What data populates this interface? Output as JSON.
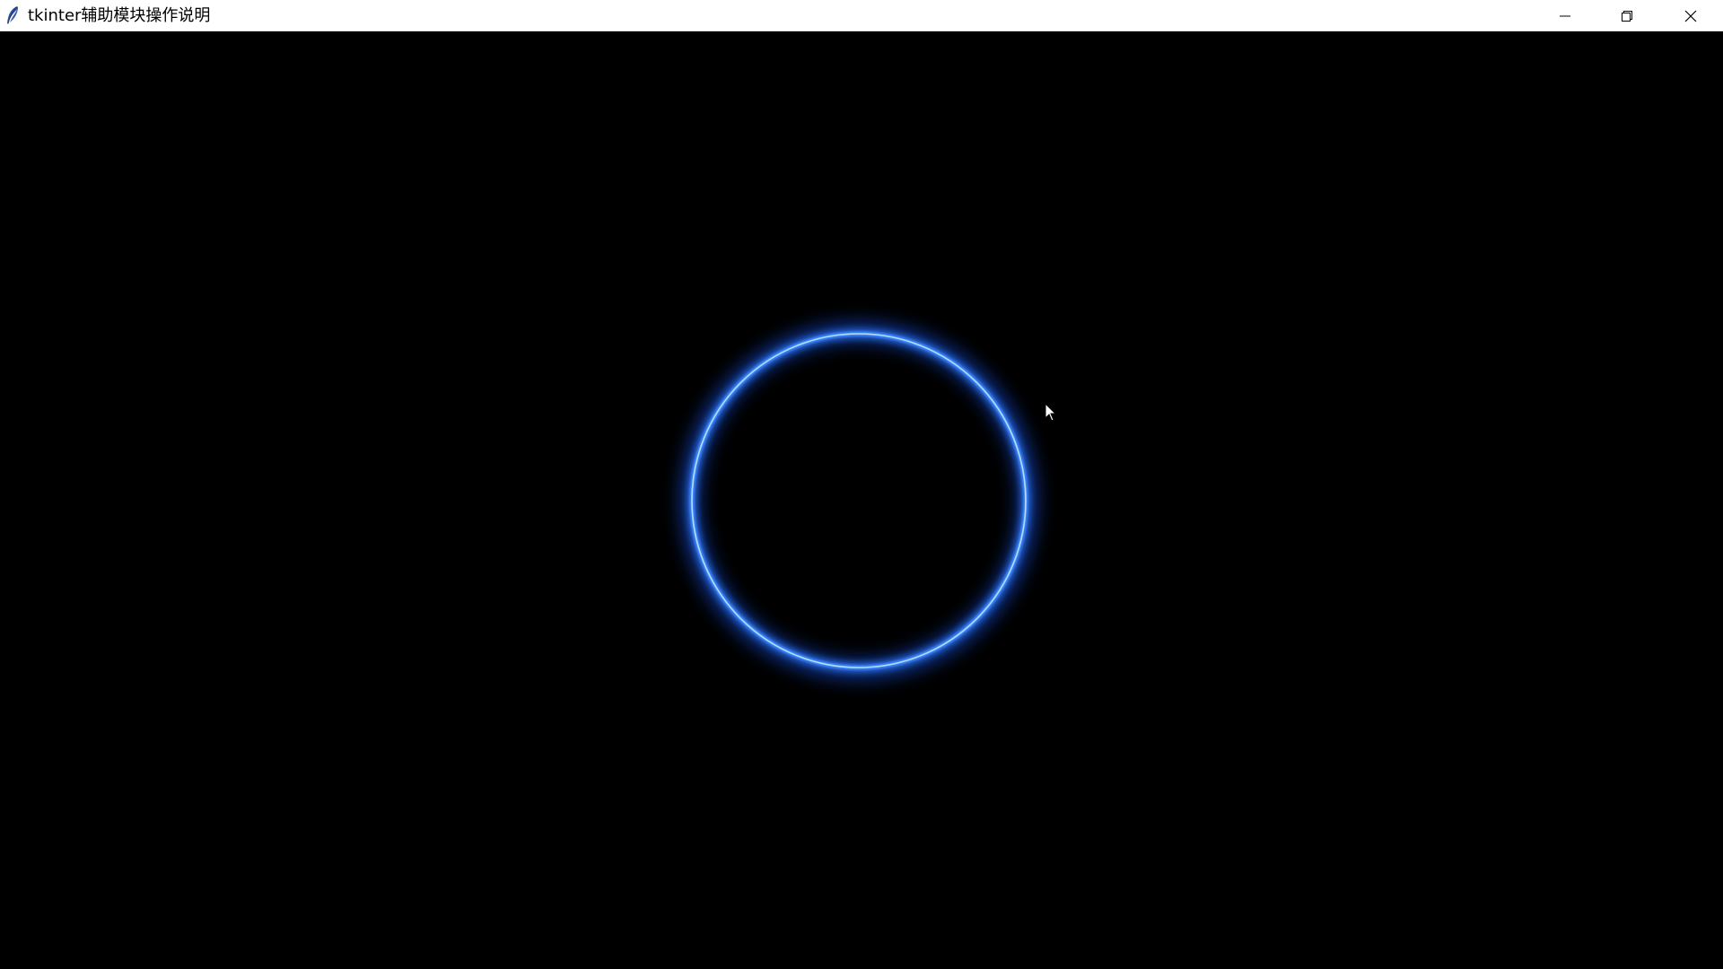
{
  "window": {
    "title": "tkinter辅助模块操作说明",
    "icon": "feather-icon",
    "controls": {
      "minimize_icon": "minimize-icon",
      "maximize_icon": "restore-icon",
      "close_icon": "close-icon"
    }
  },
  "canvas": {
    "background": "#000000",
    "ring": {
      "color": "#3f8cff",
      "glow_color": "#1e5bff",
      "highlight_color": "#bfe0ff"
    },
    "cursor_icon": "arrow-cursor-icon"
  }
}
